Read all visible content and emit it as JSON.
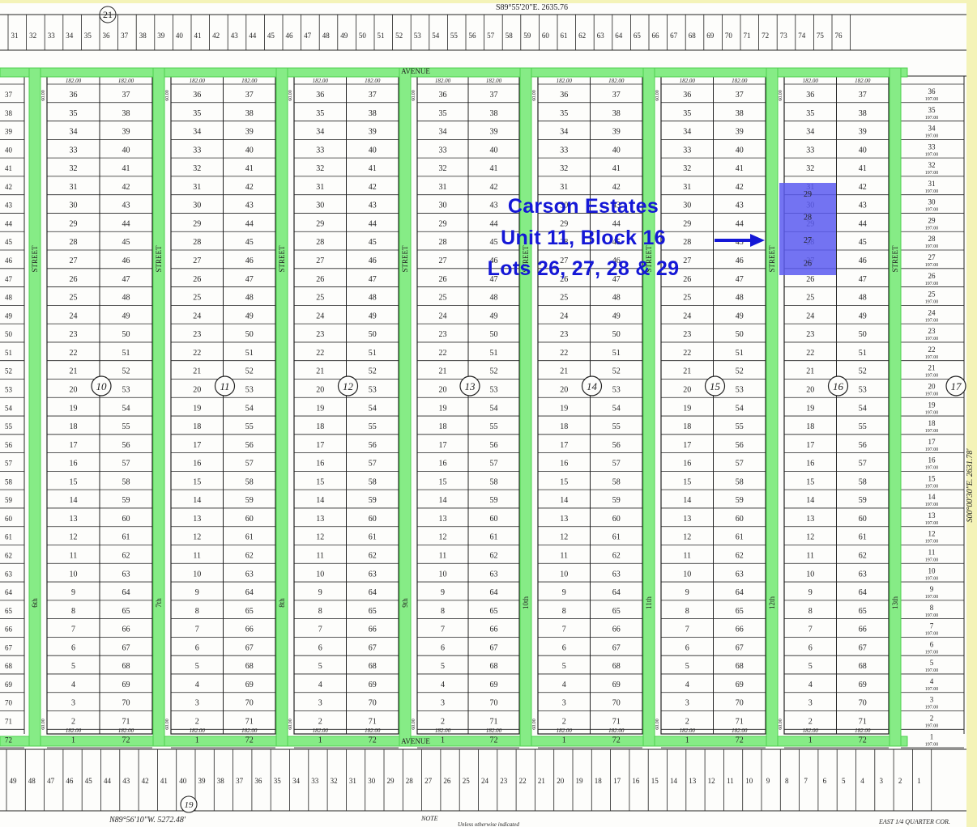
{
  "survey": {
    "top_bearing": "S89°55'20\"E.",
    "top_distance": "2635.76",
    "bottom_bearing": "N89°56'10\"W.",
    "bottom_distance": "5272.48'",
    "right_bearing": "S00°00'30\"E.",
    "right_distance": "2631.78'",
    "quarter_corner": "EAST 1/4 QUARTER COR.",
    "note": "NOTE",
    "note_line": "Unless otherwise indicated"
  },
  "streets": {
    "avenue_label": "AVENUE",
    "labels": [
      "STREET",
      "STREET",
      "STREET",
      "STREET",
      "STREET",
      "STREET",
      "STREET",
      "STREET"
    ],
    "names": [
      "6th",
      "7th",
      "8th",
      "9th",
      "10th",
      "11th",
      "12th",
      "13th"
    ]
  },
  "blocks": [
    "10",
    "11",
    "12",
    "13",
    "14",
    "15",
    "16",
    "17"
  ],
  "block_top_numbers": [
    "21"
  ],
  "lower_block_number": "19",
  "dims": {
    "lot_width": "182.00",
    "street_width": "60.00",
    "right_lot_depth": "197.00"
  },
  "lots": {
    "left": [
      "36",
      "35",
      "34",
      "33",
      "32",
      "31",
      "30",
      "29",
      "28",
      "27",
      "26",
      "25",
      "24",
      "23",
      "22",
      "21",
      "20",
      "19",
      "18",
      "17",
      "16",
      "15",
      "14",
      "13",
      "12",
      "11",
      "10",
      "9",
      "8",
      "7",
      "6",
      "5",
      "4",
      "3",
      "2",
      "1"
    ],
    "right": [
      "37",
      "38",
      "39",
      "40",
      "41",
      "42",
      "43",
      "44",
      "45",
      "46",
      "47",
      "48",
      "49",
      "50",
      "51",
      "52",
      "53",
      "54",
      "55",
      "56",
      "57",
      "58",
      "59",
      "60",
      "61",
      "62",
      "63",
      "64",
      "65",
      "66",
      "67",
      "68",
      "69",
      "70",
      "71",
      "72"
    ]
  },
  "top_row_lots": [
    "31",
    "32",
    "33",
    "34",
    "35",
    "36",
    "37",
    "38",
    "39",
    "40",
    "41",
    "42",
    "43",
    "44",
    "45",
    "46",
    "47",
    "48",
    "49",
    "50",
    "51",
    "52",
    "53",
    "54",
    "55",
    "56",
    "57",
    "58",
    "59",
    "60",
    "61",
    "62",
    "63",
    "64",
    "65",
    "66",
    "67",
    "68",
    "69",
    "70",
    "71",
    "72",
    "73",
    "74",
    "75",
    "76"
  ],
  "bottom_row_lots": [
    "49",
    "48",
    "47",
    "46",
    "45",
    "44",
    "43",
    "42",
    "41",
    "40",
    "39",
    "38",
    "37",
    "36",
    "35",
    "34",
    "33",
    "32",
    "31",
    "30",
    "29",
    "28",
    "27",
    "26",
    "25",
    "24",
    "23",
    "22",
    "21",
    "20",
    "19",
    "18",
    "17",
    "16",
    "15",
    "14",
    "13",
    "12",
    "11",
    "10",
    "9",
    "8",
    "7",
    "6",
    "5",
    "4",
    "3",
    "2",
    "1"
  ],
  "highlight": {
    "lots": [
      "29",
      "28",
      "27",
      "26"
    ],
    "color": "#5b5bf0"
  },
  "annotation": {
    "line1": "Carson Estates",
    "line2": "Unit 11, Block 16",
    "line3": "Lots 26, 27, 28 & 29",
    "color": "#1417d6"
  },
  "colors": {
    "street": "#86ec86",
    "street_edge": "#4fcf4f",
    "ink": "#222222"
  }
}
